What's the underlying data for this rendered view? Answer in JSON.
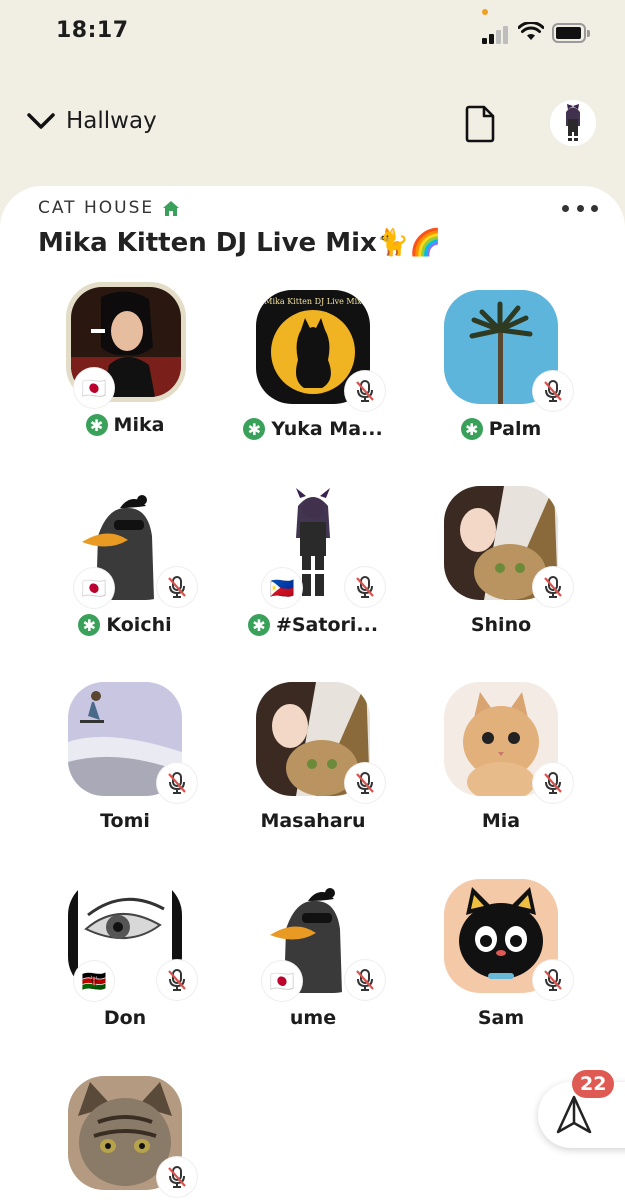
{
  "status": {
    "time": "18:17"
  },
  "nav": {
    "back_label": "Hallway"
  },
  "room": {
    "club_name": "CAT HOUSE",
    "title": "Mika Kitten DJ Live Mix🐈🌈"
  },
  "speakers": [
    {
      "name": "Mika",
      "moderator": true,
      "flag": "🇯🇵",
      "muted": false
    },
    {
      "name": "Yuka Ma...",
      "moderator": true,
      "flag": "",
      "muted": true,
      "avatar_text": "Mika Kitten DJ Live Mix"
    },
    {
      "name": "Palm",
      "moderator": true,
      "flag": "",
      "muted": true
    },
    {
      "name": "Koichi",
      "moderator": true,
      "flag": "🇯🇵",
      "muted": true
    },
    {
      "name": "#Satori...",
      "moderator": true,
      "flag": "🇵🇭",
      "muted": true
    },
    {
      "name": "Shino",
      "moderator": false,
      "flag": "",
      "muted": true
    },
    {
      "name": "Tomi",
      "moderator": false,
      "flag": "",
      "muted": true
    },
    {
      "name": "Masaharu",
      "moderator": false,
      "flag": "",
      "muted": true
    },
    {
      "name": "Mia",
      "moderator": false,
      "flag": "",
      "muted": true
    },
    {
      "name": "Don",
      "moderator": false,
      "flag": "🇰🇪",
      "muted": true
    },
    {
      "name": "ume",
      "moderator": false,
      "flag": "🇯🇵",
      "muted": true
    },
    {
      "name": "Sam",
      "moderator": false,
      "flag": "",
      "muted": true
    }
  ],
  "badge": {
    "count": "22"
  },
  "colors": {
    "background": "#f1efe4",
    "moderator_green": "#3aa15b",
    "badge_red": "#e05a54",
    "mute_red": "#d9534f"
  }
}
